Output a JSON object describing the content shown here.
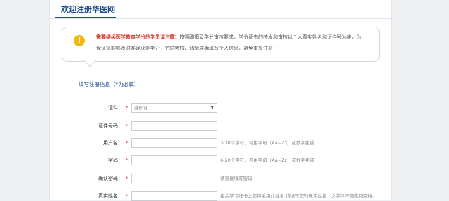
{
  "header": {
    "title": "欢迎注册华医网"
  },
  "notice": {
    "highlight": "需要继续医学教育学分的学员请注意：",
    "line1_rest": "按照政策及学分审核要求，学分证书的核发和审核以个人真实姓名和证件号为准，为",
    "line2": "保证您能够及时准确获得学分，完成考核，请您准确填写个人信息，避免重复注册！",
    "icon": "warning-icon"
  },
  "section": {
    "title": "填写注册信息（*为必填）"
  },
  "form": {
    "required_mark": "*",
    "rows": [
      {
        "label": "证件：",
        "value": "身份证"
      },
      {
        "label": "证件号码：",
        "value": ""
      },
      {
        "label": "用户名：",
        "value": "",
        "hint": "3-18个字符，可由字母（Aa~Zz）或数字组成"
      },
      {
        "label": "密码：",
        "value": "",
        "hint": "6-20个字符，可由字母（Aa~Zz）或数字组成"
      },
      {
        "label": "确认密码：",
        "value": "",
        "hint": "请重复填写密码"
      },
      {
        "label": "真实姓名：",
        "value": "",
        "hint": "相关学习证书上都将采用此姓名,请填写您的真实姓名，文字间不要使用空格。"
      }
    ]
  },
  "colors": {
    "accent": "#1e4e8c",
    "required": "#d23b2a",
    "warning": "#f2b80d"
  }
}
